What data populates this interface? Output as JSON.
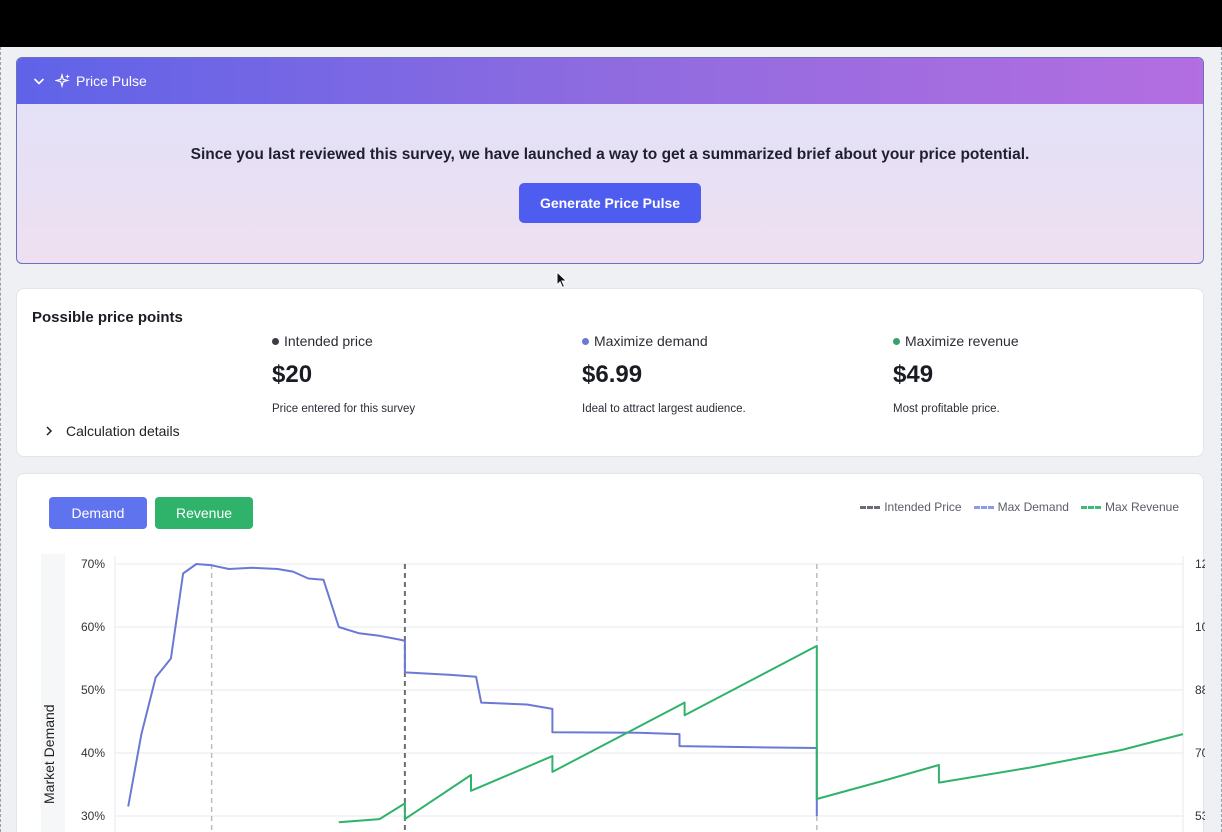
{
  "pulse": {
    "title": "Price Pulse",
    "message": "Since you last reviewed this survey, we have launched a way to get a summarized brief about your price potential.",
    "button_label": "Generate Price Pulse"
  },
  "price_points": {
    "heading": "Possible price points",
    "calc_label": "Calculation details",
    "items": [
      {
        "label": "Intended price",
        "value": "$20",
        "desc": "Price entered for this survey",
        "color": "#3a3c46"
      },
      {
        "label": "Maximize demand",
        "value": "$6.99",
        "desc": "Ideal to attract largest audience.",
        "color": "#6b79d6"
      },
      {
        "label": "Maximize revenue",
        "value": "$49",
        "desc": "Most profitable price.",
        "color": "#3aa06a"
      }
    ]
  },
  "chart": {
    "tabs": [
      {
        "label": "Demand",
        "color": "#5f73ee"
      },
      {
        "label": "Revenue",
        "color": "#2fb36b"
      }
    ],
    "legend": [
      {
        "label": "Intended Price",
        "color": "#6b6d75"
      },
      {
        "label": "Max Demand",
        "color": "#8e9ae6"
      },
      {
        "label": "Max Revenue",
        "color": "#3dbb7a"
      }
    ],
    "y_axis_label": "Market Demand",
    "left_ticks": [
      "70%",
      "60%",
      "50%",
      "40%",
      "30%"
    ],
    "right_ticks": [
      "12",
      "10",
      "88",
      "70",
      "53"
    ]
  },
  "chart_data": {
    "type": "line",
    "ylabel": "Market Demand",
    "left_axis": {
      "ticks": [
        70,
        60,
        50,
        40,
        30
      ],
      "unit": "%"
    },
    "right_axis_visible_ticks": [
      "12",
      "10",
      "88",
      "70",
      "53"
    ],
    "series": [
      {
        "name": "Demand",
        "color": "#6b79d6",
        "points": [
          [
            0.13,
            31.5
          ],
          [
            0.26,
            43
          ],
          [
            0.4,
            52
          ],
          [
            0.55,
            55
          ],
          [
            0.67,
            68.5
          ],
          [
            0.8,
            70
          ],
          [
            0.95,
            69.8
          ],
          [
            1.12,
            69.2
          ],
          [
            1.35,
            69.4
          ],
          [
            1.6,
            69.2
          ],
          [
            1.75,
            68.8
          ],
          [
            1.9,
            67.7
          ],
          [
            2.05,
            67.5
          ],
          [
            2.2,
            60
          ],
          [
            2.4,
            59
          ],
          [
            2.6,
            58.6
          ],
          [
            2.8,
            58
          ],
          [
            2.85,
            57.8
          ],
          [
            2.85,
            52.8
          ],
          [
            3.3,
            52.4
          ],
          [
            3.55,
            52.1
          ],
          [
            3.6,
            48
          ],
          [
            4.05,
            47.7
          ],
          [
            4.3,
            47
          ],
          [
            4.3,
            43.3
          ],
          [
            5.15,
            43.2
          ],
          [
            5.55,
            43
          ],
          [
            5.55,
            41.1
          ],
          [
            6.3,
            40.9
          ],
          [
            6.9,
            40.8
          ],
          [
            6.9,
            30
          ]
        ]
      },
      {
        "name": "Revenue",
        "color": "#2fb36b",
        "points": [
          [
            2.2,
            29
          ],
          [
            2.6,
            29.5
          ],
          [
            2.85,
            32
          ],
          [
            2.85,
            29.5
          ],
          [
            3.5,
            36.5
          ],
          [
            3.5,
            34
          ],
          [
            4.3,
            39.5
          ],
          [
            4.3,
            37
          ],
          [
            5.6,
            48
          ],
          [
            5.6,
            46
          ],
          [
            6.9,
            57
          ],
          [
            6.9,
            32.7
          ],
          [
            7.6,
            35.8
          ],
          [
            8.1,
            38.1
          ],
          [
            8.1,
            35.3
          ],
          [
            9,
            37.7
          ],
          [
            9.9,
            40.5
          ],
          [
            10.5,
            43
          ]
        ]
      }
    ],
    "reference_lines": [
      {
        "name": "Max Demand",
        "x": 0.95
      },
      {
        "name": "Intended Price",
        "x": 2.85
      },
      {
        "name": "Max Revenue",
        "x": 6.9
      }
    ]
  }
}
